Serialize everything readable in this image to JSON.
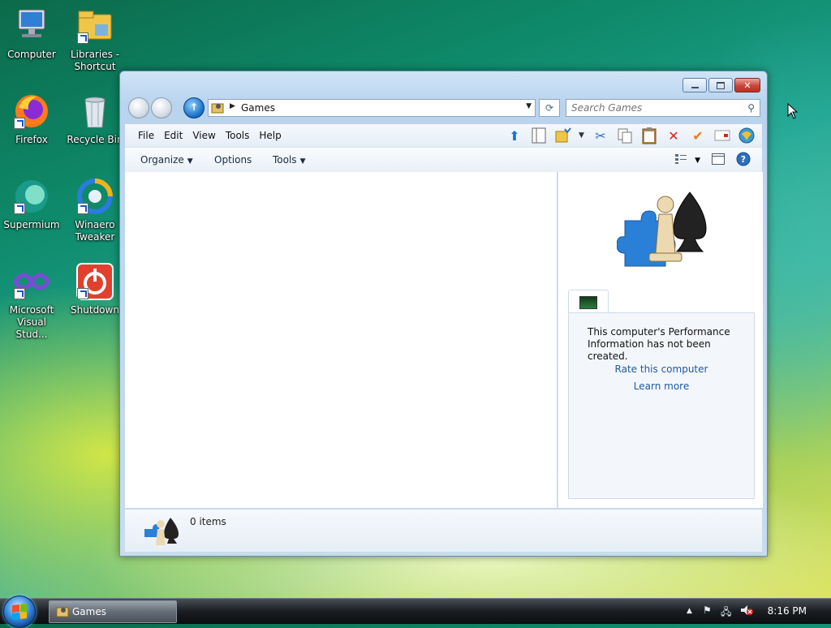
{
  "desktop": {
    "icons": [
      {
        "label": "Computer",
        "icon": "computer-icon"
      },
      {
        "label": "Libraries - Shortcut",
        "icon": "libraries-icon"
      },
      {
        "label": "Firefox",
        "icon": "firefox-icon"
      },
      {
        "label": "Recycle Bin",
        "icon": "recycle-bin-icon"
      },
      {
        "label": "Supermium",
        "icon": "supermium-icon"
      },
      {
        "label": "Winaero Tweaker",
        "icon": "winaero-tweaker-icon"
      },
      {
        "label": "Microsoft Visual Stud...",
        "icon": "visual-studio-icon"
      },
      {
        "label": "Shutdown",
        "icon": "shutdown-icon"
      }
    ]
  },
  "window": {
    "address_path": "Games",
    "search_placeholder": "Search Games",
    "menu": [
      "File",
      "Edit",
      "View",
      "Tools",
      "Help"
    ],
    "commands": {
      "organize": "Organize",
      "options": "Options",
      "tools": "Tools"
    },
    "details": {
      "perf_text": "This computer's Performance Information has not been created.",
      "rate_link": "Rate this computer",
      "learn_link": "Learn more"
    },
    "status_count": "0 items"
  },
  "taskbar": {
    "active_window": "Games",
    "clock": "8:16 PM"
  },
  "colors": {
    "link": "#1e5aa8",
    "close_button": "#c9453a",
    "taskbar": "#1a1d21"
  }
}
